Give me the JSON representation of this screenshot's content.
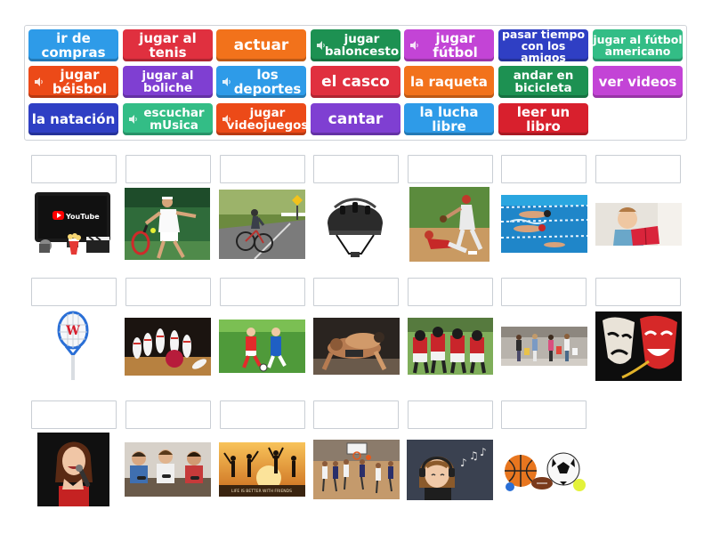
{
  "palette": {
    "blue": "#2e9be8",
    "red": "#e0303f",
    "orange": "#f2721b",
    "green": "#1d9152",
    "violet": "#c344d6",
    "navy": "#2f3fc4",
    "teal": "#33bd86",
    "orange_red": "#ec4a18",
    "purple": "#7f3fd2",
    "dark_red": "#d8202d"
  },
  "word_bank": {
    "tiles": [
      {
        "label": "ir de compras",
        "color": "#2e9be8"
      },
      {
        "label": "jugar al tenis",
        "color": "#e0303f"
      },
      {
        "label": "actuar",
        "color": "#f2721b"
      },
      {
        "label": "jugar baloncesto",
        "color": "#1d9152",
        "audio": true
      },
      {
        "label": "jugar fútbol",
        "color": "#c344d6",
        "audio": true
      },
      {
        "label": "pasar tiempo con los amigos",
        "color": "#2f3fc4"
      },
      {
        "label": "jugar al fútbol americano",
        "color": "#33bd86"
      },
      {
        "label": "jugar béisbol",
        "color": "#ec4a18",
        "audio": true
      },
      {
        "label": "jugar al boliche",
        "color": "#7f3fd2"
      },
      {
        "label": "los deportes",
        "color": "#2e9be8",
        "audio": true
      },
      {
        "label": "el casco",
        "color": "#e0303f"
      },
      {
        "label": "la raqueta",
        "color": "#f2721b"
      },
      {
        "label": "andar en bicicleta",
        "color": "#1d9152"
      },
      {
        "label": "ver videos",
        "color": "#c344d6"
      },
      {
        "label": "la natación",
        "color": "#2f3fc4"
      },
      {
        "label": "escuchar mUsica",
        "color": "#33bd86",
        "audio": true
      },
      {
        "label": "jugar videojuegos",
        "color": "#ec4a18",
        "audio": true
      },
      {
        "label": "cantar",
        "color": "#7f3fd2"
      },
      {
        "label": "la lucha libre",
        "color": "#2e9be8"
      },
      {
        "label": "leer un libro",
        "color": "#d8202d"
      }
    ]
  },
  "images": {
    "youtube_logo_text": "YouTube",
    "sign_text": "LIFE IS BETTER WITH FRIENDS",
    "items": [
      "youtube-video",
      "tennis-player",
      "cyclist",
      "helmet",
      "baseball-slide",
      "swimming",
      "reading-book",
      "racquet",
      "bowling-pins",
      "soccer-kids",
      "wrestling",
      "american-football",
      "shopping-friends",
      "theater-masks",
      "singer",
      "video-gamers",
      "friends-silhouette",
      "basketball-game",
      "listening-music",
      "sports-balls"
    ]
  }
}
